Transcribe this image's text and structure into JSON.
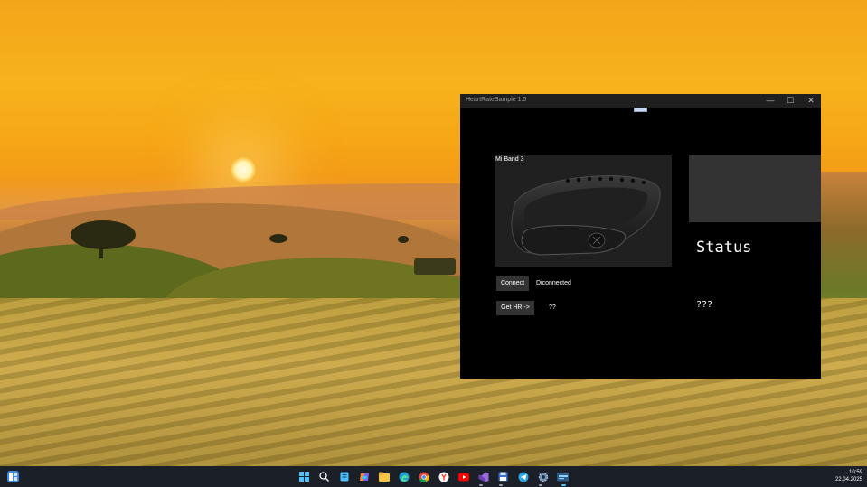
{
  "window": {
    "title": "HeartRateSample 1.0",
    "controls": {
      "minimize": "—",
      "maximize": "☐",
      "close": "✕"
    }
  },
  "device": {
    "name": "Mi Band 3"
  },
  "buttons": {
    "connect": "Connect",
    "get_hr": "Get HR ->"
  },
  "connection_status": "Diconnected",
  "heart_rate_value": "??",
  "status": {
    "heading": "Status",
    "value": "???"
  },
  "taskbar": {
    "icons": [
      "widgets-icon",
      "start-icon",
      "search-icon",
      "notes-icon",
      "copilot-icon",
      "file-explorer-icon",
      "edge-icon",
      "chrome-icon",
      "yandex-icon",
      "youtube-icon",
      "visual-studio-icon",
      "save-app-icon",
      "telegram-icon",
      "settings-icon",
      "heart-rate-app-icon"
    ],
    "time": "10:59",
    "date": "22.04.2025"
  },
  "colors": {
    "window_bg": "#000000",
    "panel_bg": "#333333",
    "taskbar_bg": "#1b1f27"
  }
}
